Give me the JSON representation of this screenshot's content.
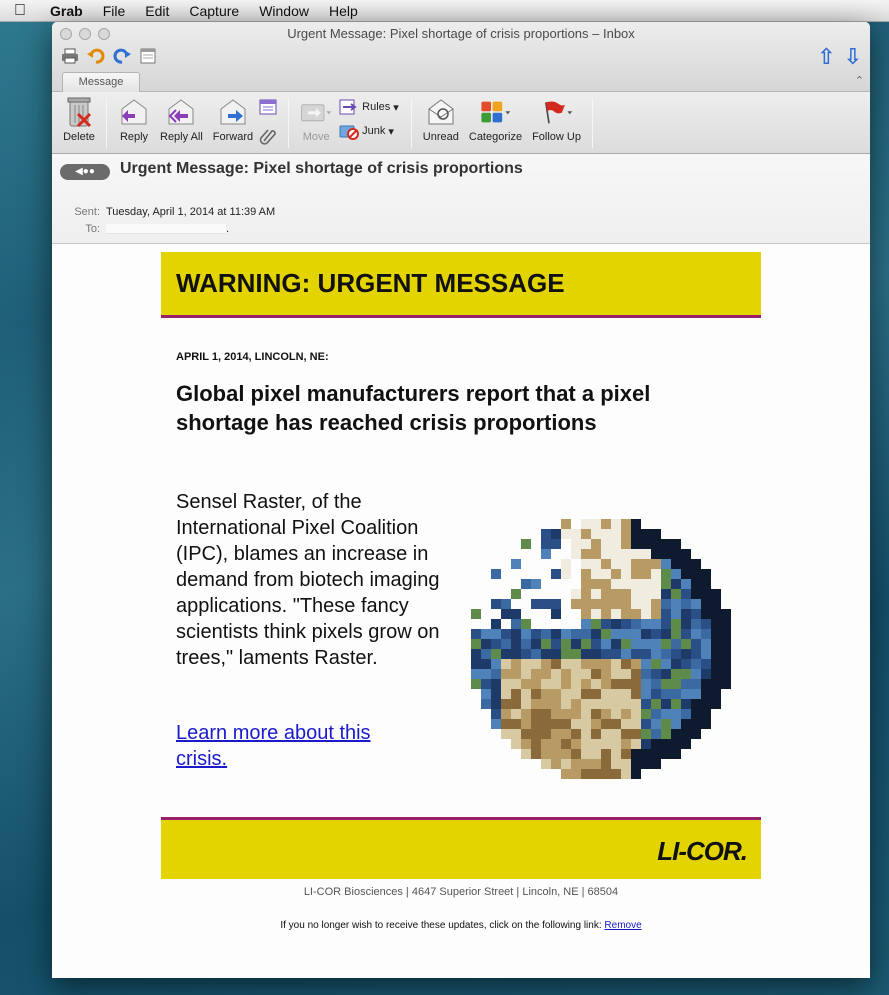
{
  "menubar": {
    "apple": "",
    "items": [
      "Grab",
      "File",
      "Edit",
      "Capture",
      "Window",
      "Help"
    ]
  },
  "window": {
    "title": "Urgent Message: Pixel shortage of crisis proportions – Inbox",
    "tab": "Message"
  },
  "ribbon": {
    "delete": "Delete",
    "reply": "Reply",
    "reply_all": "Reply All",
    "forward": "Forward",
    "move": "Move",
    "rules": "Rules",
    "junk": "Junk",
    "unread": "Unread",
    "categorize": "Categorize",
    "follow_up": "Follow Up"
  },
  "header": {
    "subject": "Urgent Message: Pixel shortage of crisis proportions",
    "sent_label": "Sent:",
    "sent_value": "Tuesday, April 1, 2014 at 11:39 AM",
    "to_label": "To:",
    "to_value": "."
  },
  "email": {
    "banner_title": "WARNING: URGENT MESSAGE",
    "dateline": "APRIL 1, 2014, LINCOLN, NE:",
    "headline": "Global pixel manufacturers report that a pixel shortage has reached crisis proportions",
    "story": "Sensel Raster, of the International Pixel Coalition (IPC), blames an increase in demand from biotech imaging applications. \"These fancy scientists think pixels grow on trees,\" laments Raster.",
    "link": "Learn more about this crisis.",
    "brand": "LI-COR.",
    "address": "LI-COR Biosciences  |  4647 Superior Street  |  Lincoln, NE  |  68504",
    "unsubscribe_text": "If you no longer wish to receive these updates, click on the following link:",
    "unsubscribe_link": "Remove"
  },
  "colors": {
    "banner_yellow": "#e3d400",
    "banner_rule": "#9a1f6b",
    "link_blue": "#1a1acc"
  }
}
